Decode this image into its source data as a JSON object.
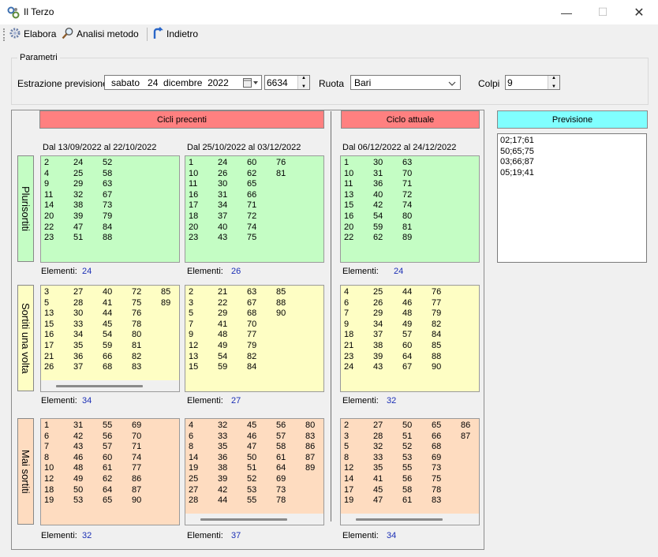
{
  "window": {
    "title": "Il Terzo",
    "minimize": "—",
    "maximize": "☐",
    "close": "✕"
  },
  "toolbar": {
    "elabora": "Elabora",
    "analisi": "Analisi metodo",
    "indietro": "Indietro"
  },
  "params": {
    "group_title": "Parametri",
    "estrazione_label": "Estrazione previsione",
    "date_value": "sabato   24  dicembre  2022",
    "number_value": "6634",
    "ruota_label": "Ruota",
    "ruota_value": "Bari",
    "colpi_label": "Colpi",
    "colpi_value": "9"
  },
  "headers": {
    "cicli_precedenti": "Cicli precenti",
    "ciclo_attuale": "Ciclo attuale",
    "previsione": "Previsione"
  },
  "periods": {
    "p1": "Dal 13/09/2022 al 22/10/2022",
    "p2": "Dal 25/10/2022 al 03/12/2022",
    "p3": "Dal 06/12/2022 al 24/12/2022"
  },
  "row_labels": {
    "plurisortiti": "Plurisortiti",
    "sortiti_una_volta": "Sortiti una volta",
    "mai_sortiti": "Mai sortiti"
  },
  "elementi_label": "Elementi:",
  "grids": {
    "plur_1": [
      [
        "2",
        "24",
        "52"
      ],
      [
        "4",
        "25",
        "58"
      ],
      [
        "9",
        "29",
        "63"
      ],
      [
        "11",
        "32",
        "67"
      ],
      [
        "14",
        "38",
        "73"
      ],
      [
        "20",
        "39",
        "79"
      ],
      [
        "22",
        "47",
        "84"
      ],
      [
        "23",
        "51",
        "88"
      ]
    ],
    "plur_2": [
      [
        "1",
        "24",
        "60",
        "76"
      ],
      [
        "10",
        "26",
        "62",
        "81"
      ],
      [
        "11",
        "30",
        "65"
      ],
      [
        "16",
        "31",
        "66"
      ],
      [
        "17",
        "34",
        "71"
      ],
      [
        "18",
        "37",
        "72"
      ],
      [
        "20",
        "40",
        "74"
      ],
      [
        "23",
        "43",
        "75"
      ]
    ],
    "plur_3": [
      [
        "1",
        "30",
        "63"
      ],
      [
        "10",
        "31",
        "70"
      ],
      [
        "11",
        "36",
        "71"
      ],
      [
        "13",
        "40",
        "72"
      ],
      [
        "15",
        "42",
        "74"
      ],
      [
        "16",
        "54",
        "80"
      ],
      [
        "20",
        "59",
        "81"
      ],
      [
        "22",
        "62",
        "89"
      ]
    ],
    "una_1": [
      [
        "3",
        "27",
        "40",
        "72",
        "85"
      ],
      [
        "5",
        "28",
        "41",
        "75",
        "89"
      ],
      [
        "13",
        "30",
        "44",
        "76"
      ],
      [
        "15",
        "33",
        "45",
        "78"
      ],
      [
        "16",
        "34",
        "54",
        "80"
      ],
      [
        "17",
        "35",
        "59",
        "81"
      ],
      [
        "21",
        "36",
        "66",
        "82"
      ],
      [
        "26",
        "37",
        "68",
        "83"
      ]
    ],
    "una_2": [
      [
        "2",
        "21",
        "63",
        "85"
      ],
      [
        "3",
        "22",
        "67",
        "88"
      ],
      [
        "5",
        "29",
        "68",
        "90"
      ],
      [
        "7",
        "41",
        "70"
      ],
      [
        "9",
        "48",
        "77"
      ],
      [
        "12",
        "49",
        "79"
      ],
      [
        "13",
        "54",
        "82"
      ],
      [
        "15",
        "59",
        "84"
      ]
    ],
    "una_3": [
      [
        "4",
        "25",
        "44",
        "76"
      ],
      [
        "6",
        "26",
        "46",
        "77"
      ],
      [
        "7",
        "29",
        "48",
        "79"
      ],
      [
        "9",
        "34",
        "49",
        "82"
      ],
      [
        "18",
        "37",
        "57",
        "84"
      ],
      [
        "21",
        "38",
        "60",
        "85"
      ],
      [
        "23",
        "39",
        "64",
        "88"
      ],
      [
        "24",
        "43",
        "67",
        "90"
      ]
    ],
    "mai_1": [
      [
        "1",
        "31",
        "55",
        "69"
      ],
      [
        "6",
        "42",
        "56",
        "70"
      ],
      [
        "7",
        "43",
        "57",
        "71"
      ],
      [
        "8",
        "46",
        "60",
        "74"
      ],
      [
        "10",
        "48",
        "61",
        "77"
      ],
      [
        "12",
        "49",
        "62",
        "86"
      ],
      [
        "18",
        "50",
        "64",
        "87"
      ],
      [
        "19",
        "53",
        "65",
        "90"
      ]
    ],
    "mai_2": [
      [
        "4",
        "32",
        "45",
        "56",
        "80"
      ],
      [
        "6",
        "33",
        "46",
        "57",
        "83"
      ],
      [
        "8",
        "35",
        "47",
        "58",
        "86"
      ],
      [
        "14",
        "36",
        "50",
        "61",
        "87"
      ],
      [
        "19",
        "38",
        "51",
        "64",
        "89"
      ],
      [
        "25",
        "39",
        "52",
        "69"
      ],
      [
        "27",
        "42",
        "53",
        "73"
      ],
      [
        "28",
        "44",
        "55",
        "78"
      ]
    ],
    "mai_3": [
      [
        "2",
        "27",
        "50",
        "65",
        "86"
      ],
      [
        "3",
        "28",
        "51",
        "66",
        "87"
      ],
      [
        "5",
        "32",
        "52",
        "68"
      ],
      [
        "8",
        "33",
        "53",
        "69"
      ],
      [
        "12",
        "35",
        "55",
        "73"
      ],
      [
        "14",
        "41",
        "56",
        "75"
      ],
      [
        "17",
        "45",
        "58",
        "78"
      ],
      [
        "19",
        "47",
        "61",
        "83"
      ]
    ]
  },
  "counts": {
    "plur_1": "24",
    "plur_2": "26",
    "plur_3": "24",
    "una_1": "34",
    "una_2": "27",
    "una_3": "32",
    "mai_1": "32",
    "mai_2": "37",
    "mai_3": "34"
  },
  "previsione": [
    "02;17;61",
    "50;65;75",
    "03;66;87",
    "05;19;41"
  ]
}
